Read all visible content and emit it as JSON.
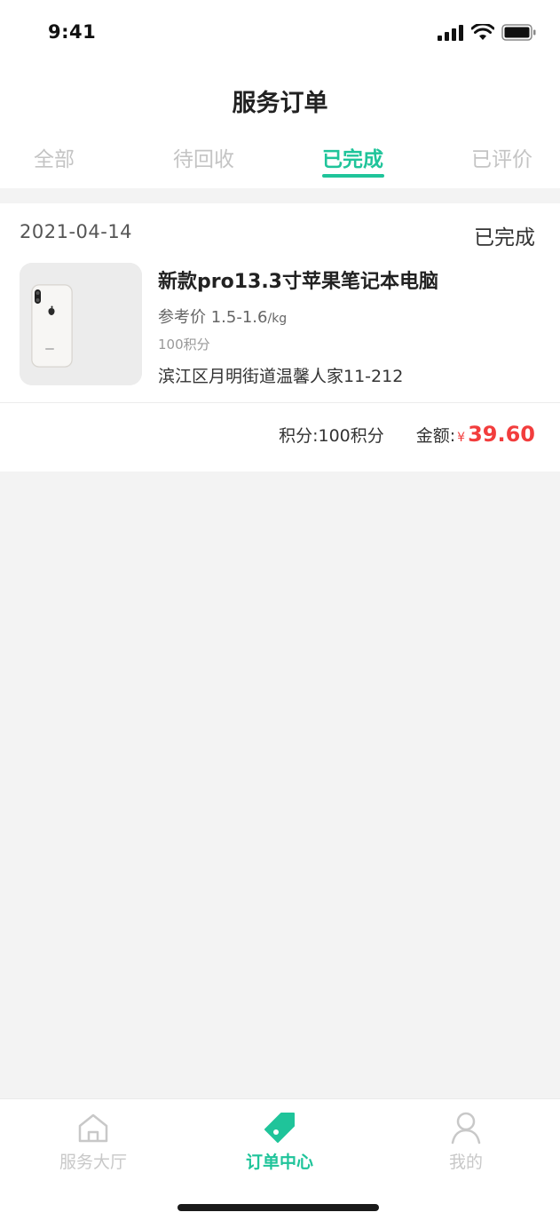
{
  "status_bar": {
    "time": "9:41",
    "icons": [
      "signal-icon",
      "wifi-icon",
      "battery-icon"
    ]
  },
  "header": {
    "title": "服务订单"
  },
  "tabs": [
    {
      "label": "全部",
      "active": false
    },
    {
      "label": "待回收",
      "active": false
    },
    {
      "label": "已完成",
      "active": true
    },
    {
      "label": "已评价",
      "active": false
    }
  ],
  "order": {
    "date": "2021-04-14",
    "status": "已完成",
    "product": {
      "image": "phone-product-photo",
      "name": "新款pro13.3寸苹果笔记本电脑",
      "price_label": "参考价",
      "price_range": "1.5-1.6",
      "price_unit": "/kg",
      "points": "100积分",
      "address": "滨江区月明街道温馨人家11-212"
    },
    "summary": {
      "points_label": "积分:",
      "points_value": "100积分",
      "amount_label": "金额:",
      "currency": "¥",
      "amount": "39.60"
    }
  },
  "tabbar": {
    "items": [
      {
        "label": "服务大厅",
        "icon": "home-icon",
        "active": false
      },
      {
        "label": "订单中心",
        "icon": "tag-icon",
        "active": true
      },
      {
        "label": "我的",
        "icon": "user-icon",
        "active": false
      }
    ]
  },
  "colors": {
    "accent": "#1fc49a",
    "price": "#f23d3d",
    "background": "#f3f3f3"
  }
}
